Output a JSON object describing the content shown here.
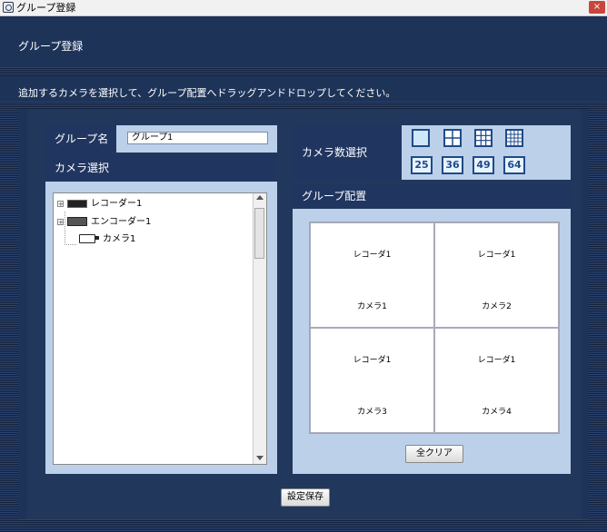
{
  "window": {
    "title": "グループ登録",
    "close_label": "×"
  },
  "header": {
    "title": "グループ登録"
  },
  "instruction": "追加するカメラを選択して、グループ配置へドラッグアンドドロップしてください。",
  "group_name": {
    "label": "グループ名",
    "value": "グループ1"
  },
  "camera_select": {
    "header": "カメラ選択",
    "tree": [
      {
        "label": "レコーダー1",
        "type": "recorder",
        "expander": "+"
      },
      {
        "label": "エンコーダー1",
        "type": "encoder",
        "expander": "+"
      },
      {
        "label": "カメラ1",
        "type": "camera"
      }
    ]
  },
  "camera_count": {
    "label": "カメラ数選択",
    "layouts": [
      "1",
      "4",
      "9",
      "16"
    ],
    "numbers": [
      "25",
      "36",
      "49",
      "64"
    ],
    "selected": "1"
  },
  "arrangement": {
    "header": "グループ配置",
    "cells": [
      {
        "recorder": "レコーダ1",
        "camera": "カメラ1"
      },
      {
        "recorder": "レコーダ1",
        "camera": "カメラ2"
      },
      {
        "recorder": "レコーダ1",
        "camera": "カメラ3"
      },
      {
        "recorder": "レコーダ1",
        "camera": "カメラ4"
      }
    ],
    "clear_all": "全クリア"
  },
  "save_button": "設定保存",
  "colors": {
    "background": "#1e3358",
    "panel": "#bcd0ea",
    "header_bar": "#203560",
    "accent": "#1f4a8a"
  }
}
